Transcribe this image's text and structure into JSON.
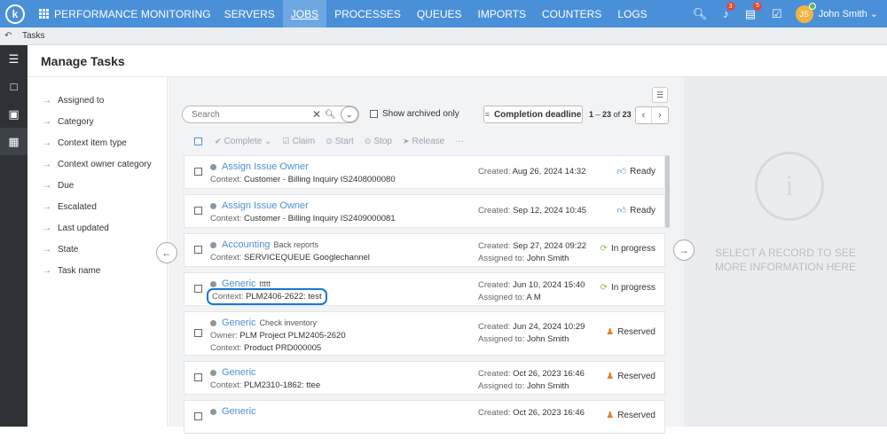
{
  "app": {
    "logo_letter": "k",
    "brand": "PERFORMANCE MONITORING",
    "nav": [
      "SERVERS",
      "JOBS",
      "PROCESSES",
      "QUEUES",
      "IMPORTS",
      "COUNTERS",
      "LOGS"
    ],
    "active_nav": "JOBS",
    "bell_badge": "3",
    "tasks_badge": "5",
    "user_initials": "JS",
    "user_name": "John Smith"
  },
  "breadcrumb": {
    "current": "Tasks"
  },
  "page": {
    "title": "Manage Tasks"
  },
  "filters": [
    "Assigned to",
    "Category",
    "Context item type",
    "Context owner category",
    "Due",
    "Escalated",
    "Last updated",
    "State",
    "Task name"
  ],
  "toolbar": {
    "search_placeholder": "Search",
    "show_archived": "Show archived only",
    "sort_label": "Completion deadline",
    "range_start": "1",
    "range_end": "23",
    "range_of": "of",
    "total": "23",
    "actions": {
      "complete": "Complete",
      "claim": "Claim",
      "start": "Start",
      "stop": "Stop",
      "release": "Release",
      "more": "···"
    }
  },
  "labels": {
    "context": "Context:",
    "owner": "Owner:",
    "created": "Created:",
    "assigned": "Assigned to:"
  },
  "tasks": [
    {
      "name": "Assign Issue Owner",
      "sub": "",
      "owner": "",
      "context": "Customer - Billing Inquiry IS2408000080",
      "created": "Aug 26, 2024 14:32",
      "assigned": "",
      "status": "Ready"
    },
    {
      "name": "Assign Issue Owner",
      "sub": "",
      "owner": "",
      "context": "Customer - Billing Inquiry IS2409000081",
      "created": "Sep 12, 2024 10:45",
      "assigned": "",
      "status": "Ready"
    },
    {
      "name": "Accounting",
      "sub": "Back reports",
      "owner": "",
      "context": "SERVICEQUEUE Googlechannel",
      "created": "Sep 27, 2024 09:22",
      "assigned": "John Smith",
      "status": "In progress"
    },
    {
      "name": "Generic",
      "sub": "ttttt",
      "owner": "",
      "context": "PLM2406-2622: test",
      "created": "Jun 10, 2024 15:40",
      "assigned": "A M",
      "status": "In progress"
    },
    {
      "name": "Generic",
      "sub": "Check inventory",
      "owner": "PLM Project PLM2405-2620",
      "context": "Product PRD000005",
      "created": "Jun 24, 2024 10:29",
      "assigned": "John Smith",
      "status": "Reserved"
    },
    {
      "name": "Generic",
      "sub": "",
      "owner": "",
      "context": "PLM2310-1862: ttee",
      "created": "Oct 26, 2023 16:46",
      "assigned": "John Smith",
      "status": "Reserved"
    },
    {
      "name": "Generic",
      "sub": "",
      "owner": "",
      "context": "",
      "created": "Oct 26, 2023 16:46",
      "assigned": "",
      "status": "Reserved"
    }
  ],
  "detail": {
    "message": "SELECT A RECORD TO SEE MORE INFORMATION HERE"
  },
  "colors": {
    "topbar": "#4a90d9",
    "link": "#4a90d9",
    "highlight": "#1976d2",
    "rail": "#2e3237"
  }
}
